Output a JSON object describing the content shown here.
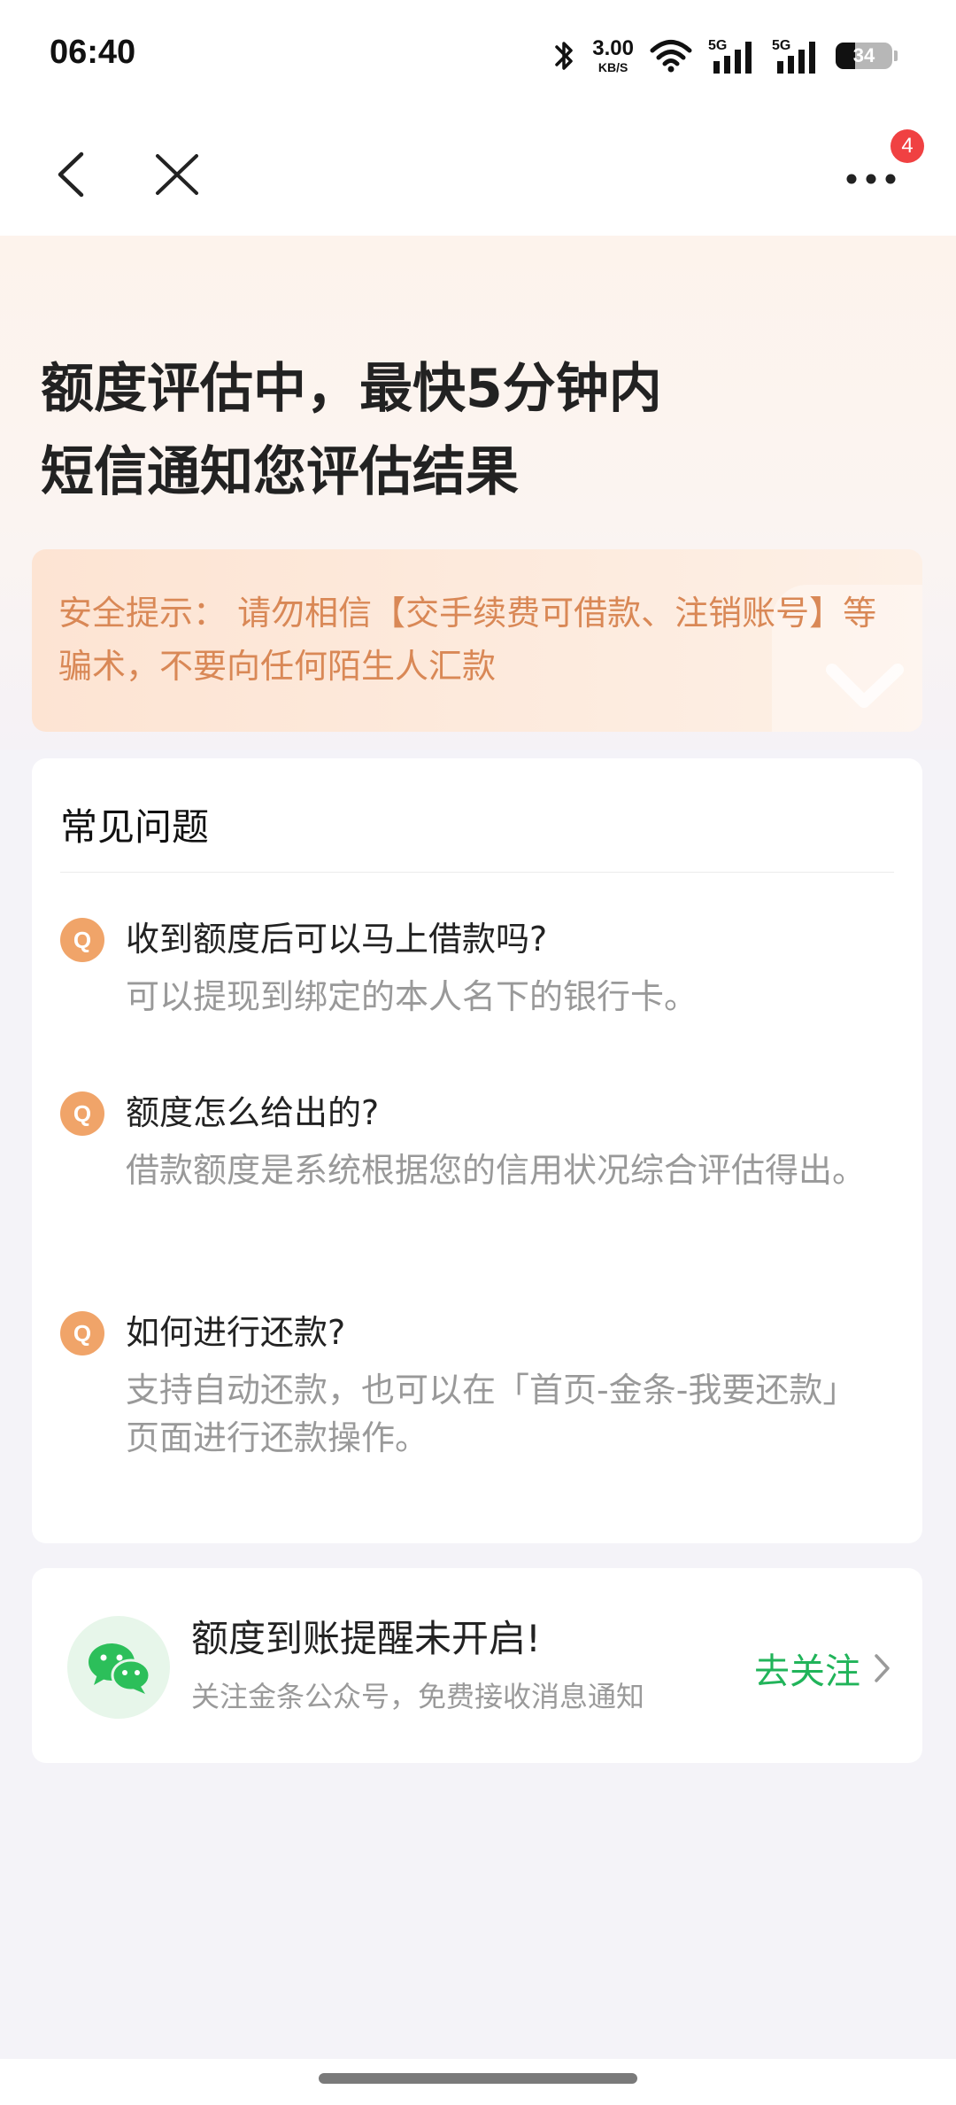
{
  "status_bar": {
    "time": "06:40",
    "speed_value": "3.00",
    "speed_unit": "KB/S",
    "network_1": "5G",
    "network_2": "5G",
    "battery_level": "34"
  },
  "nav": {
    "badge_count": "4"
  },
  "hero": {
    "title_line1": "额度评估中，最快5分钟内",
    "title_line2": "短信通知您评估结果",
    "tip_text": "安全提示： 请勿相信【交手续费可借款、注销账号】等骗术，不要向任何陌生人汇款"
  },
  "faq": {
    "title": "常见问题",
    "q_icon_letter": "Q",
    "items": [
      {
        "question": "收到额度后可以马上借款吗?",
        "answer": "可以提现到绑定的本人名下的银行卡。"
      },
      {
        "question": "额度怎么给出的?",
        "answer": "借款额度是系统根据您的信用状况综合评估得出。"
      },
      {
        "question": "如何进行还款?",
        "answer": "支持自动还款，也可以在「首页-金条-我要还款」页面进行还款操作。"
      }
    ]
  },
  "follow": {
    "title": "额度到账提醒未开启!",
    "subtitle": "关注金条公众号，免费接收消息通知",
    "button_label": "去关注"
  },
  "colors": {
    "accent_orange": "#f0a469",
    "tip_text": "#d98856",
    "follow_green": "#21b45a",
    "badge_red": "#f04142"
  }
}
